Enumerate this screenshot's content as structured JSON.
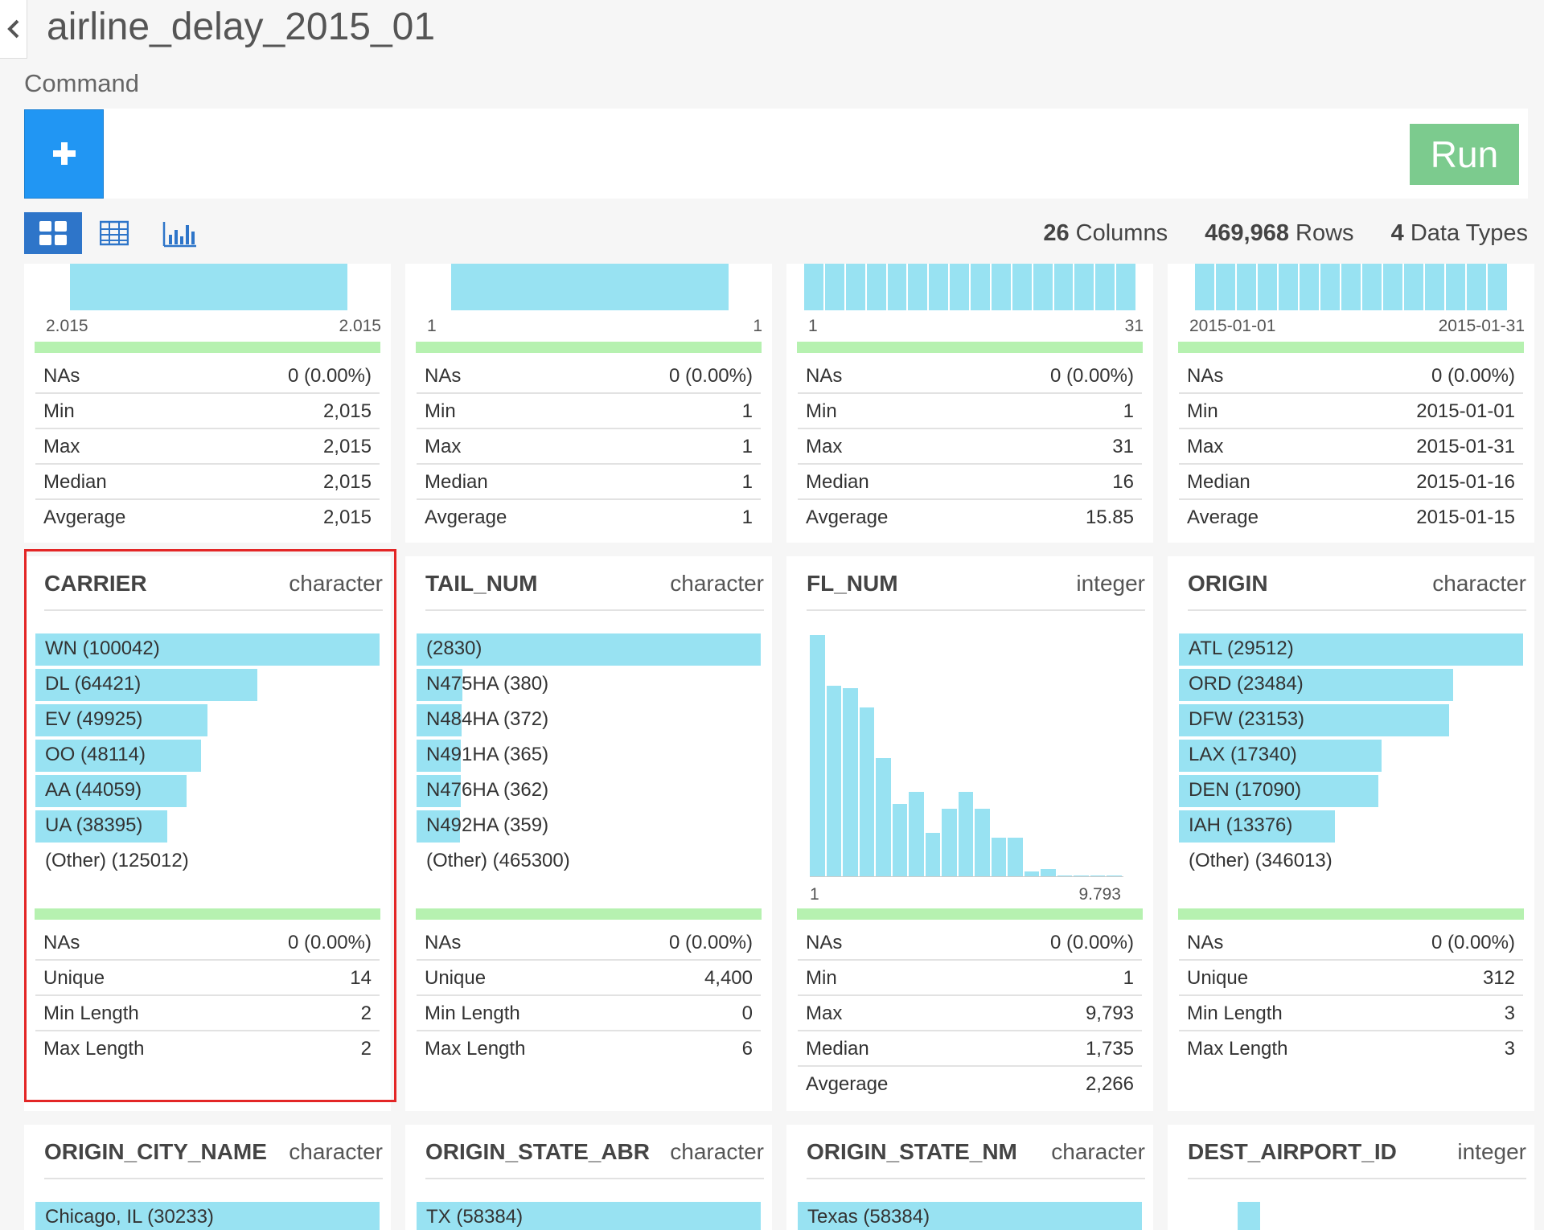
{
  "title": "airline_delay_2015_01",
  "command_label": "Command",
  "add_icon": "plus-icon",
  "run_label": "Run",
  "view_icons": [
    "grid-view-icon",
    "table-view-icon",
    "chart-view-icon"
  ],
  "summary": {
    "columns_count": "26",
    "columns_label": "Columns",
    "rows_count": "469,968",
    "rows_label": "Rows",
    "types_count": "4",
    "types_label": "Data Types"
  },
  "colors": {
    "bar": "#98e2f2",
    "green": "#b6f1b0",
    "accent": "#2196f3",
    "run": "#7ccb8e",
    "highlight": "#e32626"
  },
  "row1": [
    {
      "axis": [
        "2.015",
        "2.015"
      ],
      "hist": [
        1
      ],
      "stats": [
        [
          "NAs",
          "0 (0.00%)"
        ],
        [
          "Min",
          "2,015"
        ],
        [
          "Max",
          "2,015"
        ],
        [
          "Median",
          "2,015"
        ],
        [
          "Avgerage",
          "2,015"
        ]
      ]
    },
    {
      "axis": [
        "1",
        "1"
      ],
      "hist": [
        1
      ],
      "stats": [
        [
          "NAs",
          "0 (0.00%)"
        ],
        [
          "Min",
          "1"
        ],
        [
          "Max",
          "1"
        ],
        [
          "Median",
          "1"
        ],
        [
          "Avgerage",
          "1"
        ]
      ]
    },
    {
      "axis": [
        "1",
        "31"
      ],
      "hist": [
        1,
        1,
        1,
        1,
        1,
        1,
        1,
        1,
        1,
        1,
        1,
        1,
        1,
        1,
        1,
        1
      ],
      "stats": [
        [
          "NAs",
          "0 (0.00%)"
        ],
        [
          "Min",
          "1"
        ],
        [
          "Max",
          "31"
        ],
        [
          "Median",
          "16"
        ],
        [
          "Avgerage",
          "15.85"
        ]
      ]
    },
    {
      "axis": [
        "2015-01-01",
        "2015-01-31"
      ],
      "hist": [
        1,
        1,
        1,
        1,
        1,
        1,
        1,
        1,
        1,
        1,
        1,
        1,
        1,
        1,
        1
      ],
      "stats": [
        [
          "NAs",
          "0 (0.00%)"
        ],
        [
          "Min",
          "2015-01-01"
        ],
        [
          "Max",
          "2015-01-31"
        ],
        [
          "Median",
          "2015-01-16"
        ],
        [
          "Average",
          "2015-01-15"
        ]
      ]
    }
  ],
  "row2": [
    {
      "name": "CARRIER",
      "type": "character",
      "bars": [
        [
          "WN (100042)",
          1.0
        ],
        [
          "DL (64421)",
          0.644
        ],
        [
          "EV (49925)",
          0.499
        ],
        [
          "OO (48114)",
          0.481
        ],
        [
          "AA (44059)",
          0.44
        ],
        [
          "UA (38395)",
          0.384
        ]
      ],
      "other": "(Other) (125012)",
      "stats": [
        [
          "NAs",
          "0 (0.00%)"
        ],
        [
          "Unique",
          "14"
        ],
        [
          "Min Length",
          "2"
        ],
        [
          "Max Length",
          "2"
        ]
      ]
    },
    {
      "name": "TAIL_NUM",
      "type": "character",
      "bars": [
        [
          "(2830)",
          1.0
        ],
        [
          "N475HA (380)",
          0.134
        ],
        [
          "N484HA (372)",
          0.131
        ],
        [
          "N491HA (365)",
          0.129
        ],
        [
          "N476HA (362)",
          0.128
        ],
        [
          "N492HA (359)",
          0.127
        ]
      ],
      "other": "(Other) (465300)",
      "stats": [
        [
          "NAs",
          "0 (0.00%)"
        ],
        [
          "Unique",
          "4,400"
        ],
        [
          "Min Length",
          "0"
        ],
        [
          "Max Length",
          "6"
        ]
      ]
    },
    {
      "name": "FL_NUM",
      "type": "integer",
      "hist": [
        1.0,
        0.79,
        0.78,
        0.7,
        0.49,
        0.3,
        0.35,
        0.18,
        0.28,
        0.35,
        0.28,
        0.16,
        0.16,
        0.02,
        0.03,
        0.005,
        0.005,
        0.005,
        0.005
      ],
      "axis": [
        "1",
        "9.793"
      ],
      "stats": [
        [
          "NAs",
          "0 (0.00%)"
        ],
        [
          "Min",
          "1"
        ],
        [
          "Max",
          "9,793"
        ],
        [
          "Median",
          "1,735"
        ],
        [
          "Avgerage",
          "2,266"
        ]
      ]
    },
    {
      "name": "ORIGIN",
      "type": "character",
      "bars": [
        [
          "ATL (29512)",
          1.0
        ],
        [
          "ORD (23484)",
          0.796
        ],
        [
          "DFW (23153)",
          0.785
        ],
        [
          "LAX (17340)",
          0.588
        ],
        [
          "DEN (17090)",
          0.579
        ],
        [
          "IAH (13376)",
          0.453
        ]
      ],
      "other": "(Other) (346013)",
      "stats": [
        [
          "NAs",
          "0 (0.00%)"
        ],
        [
          "Unique",
          "312"
        ],
        [
          "Min Length",
          "3"
        ],
        [
          "Max Length",
          "3"
        ]
      ]
    }
  ],
  "row3": [
    {
      "name": "ORIGIN_CITY_NAME",
      "type": "character",
      "first": "Chicago, IL (30233)"
    },
    {
      "name": "ORIGIN_STATE_ABR",
      "type": "character",
      "first": "TX (58384)"
    },
    {
      "name": "ORIGIN_STATE_NM",
      "type": "character",
      "first": "Texas (58384)"
    },
    {
      "name": "DEST_AIRPORT_ID",
      "type": "integer",
      "first": ""
    }
  ]
}
